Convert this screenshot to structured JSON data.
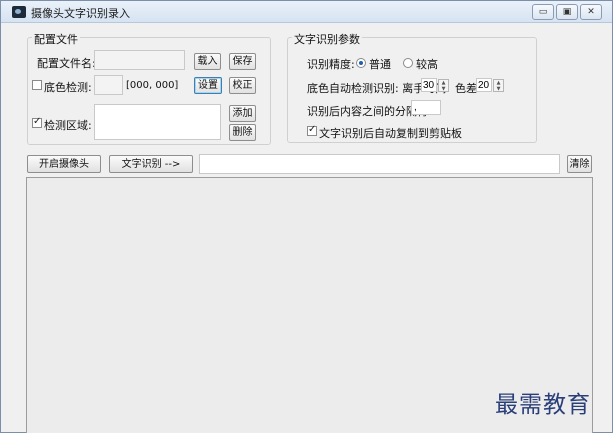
{
  "window": {
    "title": "摄像头文字识别录入",
    "min_symbol": "▭",
    "max_symbol": "▣",
    "close_symbol": "✕"
  },
  "config_group": {
    "title": "配置文件",
    "config_file_label": "配置文件名:",
    "config_file_value": "",
    "load_button": "载入",
    "save_button": "保存",
    "bg_detect_label": "底色检测:",
    "bg_detect_checked": false,
    "bg_detect_coords": "[000, 000]",
    "set_button": "设置",
    "calibrate_button": "校正",
    "detect_area_label": "检测区域:",
    "detect_area_checked": true,
    "detect_area_value": "",
    "add_button": "添加",
    "delete_button": "删除"
  },
  "ocr_group": {
    "title": "文字识别参数",
    "accuracy_label": "识别精度:",
    "accuracy_options": [
      "普通",
      "较高"
    ],
    "accuracy_selected": "普通",
    "auto_detect_label": "底色自动检测识别: 离手时间",
    "hand_off_time": "30",
    "color_diff_label": "色差",
    "color_diff": "20",
    "separator_label": "识别后内容之间的分隔符:",
    "separator_value": ",",
    "auto_copy_label": "文字识别后自动复制到剪贴板",
    "auto_copy_checked": true
  },
  "toolbar": {
    "open_camera_button": "开启摄像头",
    "recognize_button": "文字识别 -->",
    "result_value": "",
    "clear_button": "清除"
  },
  "output_area": {
    "value": ""
  },
  "watermark": {
    "text": "最需教育"
  }
}
